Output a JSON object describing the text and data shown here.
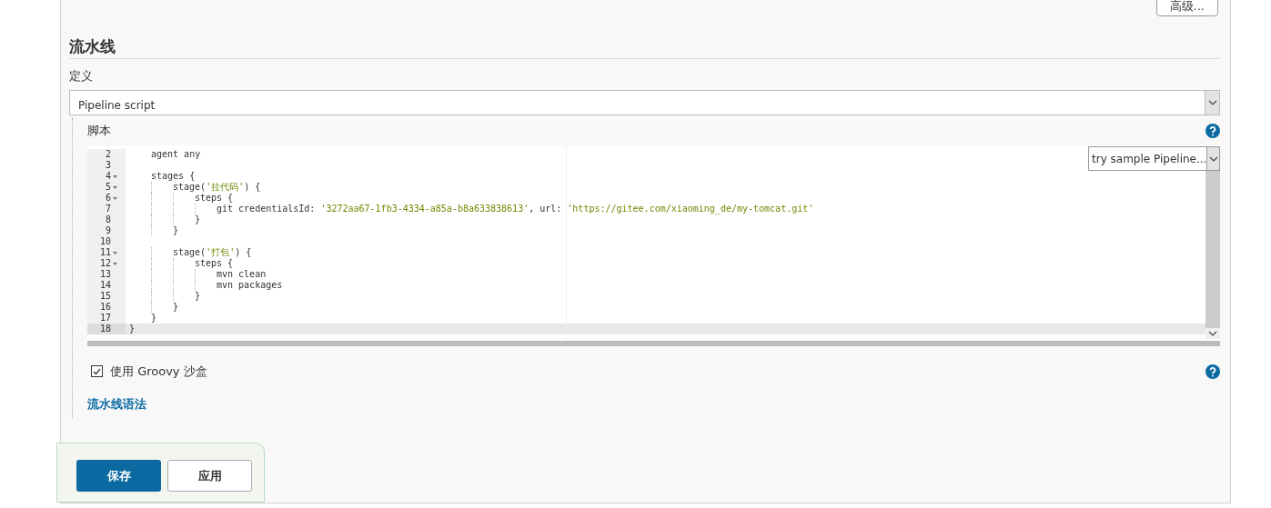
{
  "advanced_button": "高级...",
  "section_title": "流水线",
  "definition": {
    "label": "定义",
    "value": "Pipeline script"
  },
  "script": {
    "label": "脚本",
    "sample_select": "try sample Pipeline...",
    "lines": [
      {
        "number": "2",
        "foldable": false,
        "active": false,
        "segments": [
          {
            "kind": "plain",
            "text": "    agent any"
          }
        ]
      },
      {
        "number": "3",
        "foldable": false,
        "active": false
      },
      {
        "number": "4",
        "foldable": true,
        "active": false,
        "segments": [
          {
            "kind": "plain",
            "text": "    stages {"
          }
        ]
      },
      {
        "number": "5",
        "foldable": true,
        "active": false,
        "segments": [
          {
            "kind": "plain",
            "text": "        stage("
          },
          {
            "kind": "string",
            "text": "'拉代码'"
          },
          {
            "kind": "plain",
            "text": ") {"
          }
        ]
      },
      {
        "number": "6",
        "foldable": true,
        "active": false,
        "segments": [
          {
            "kind": "plain",
            "text": "            steps {"
          }
        ]
      },
      {
        "number": "7",
        "foldable": false,
        "active": false,
        "segments": [
          {
            "kind": "plain",
            "text": "                git credentialsId: "
          },
          {
            "kind": "string",
            "text": "'3272aa67-1fb3-4334-a85a-b8a633838613'"
          },
          {
            "kind": "plain",
            "text": ", url: "
          },
          {
            "kind": "string",
            "text": "'https://gitee.com/xiaoming_de/my-tomcat.git'"
          }
        ]
      },
      {
        "number": "8",
        "foldable": false,
        "active": false,
        "segments": [
          {
            "kind": "plain",
            "text": "            }"
          }
        ]
      },
      {
        "number": "9",
        "foldable": false,
        "active": false,
        "segments": [
          {
            "kind": "plain",
            "text": "        }"
          }
        ]
      },
      {
        "number": "10",
        "foldable": false,
        "active": false
      },
      {
        "number": "11",
        "foldable": true,
        "active": false,
        "segments": [
          {
            "kind": "plain",
            "text": "        stage("
          },
          {
            "kind": "string",
            "text": "'打包'"
          },
          {
            "kind": "plain",
            "text": ") {"
          }
        ]
      },
      {
        "number": "12",
        "foldable": true,
        "active": false,
        "segments": [
          {
            "kind": "plain",
            "text": "            steps {"
          }
        ]
      },
      {
        "number": "13",
        "foldable": false,
        "active": false,
        "segments": [
          {
            "kind": "plain",
            "text": "                mvn clean"
          }
        ]
      },
      {
        "number": "14",
        "foldable": false,
        "active": false,
        "segments": [
          {
            "kind": "plain",
            "text": "                mvn packages"
          }
        ]
      },
      {
        "number": "15",
        "foldable": false,
        "active": false,
        "segments": [
          {
            "kind": "plain",
            "text": "            }"
          }
        ]
      },
      {
        "number": "16",
        "foldable": false,
        "active": false,
        "segments": [
          {
            "kind": "plain",
            "text": "        }"
          }
        ]
      },
      {
        "number": "17",
        "foldable": false,
        "active": false,
        "segments": [
          {
            "kind": "plain",
            "text": "    }"
          }
        ]
      },
      {
        "number": "18",
        "foldable": false,
        "active": true,
        "segments": [
          {
            "kind": "plain",
            "text": "}"
          }
        ]
      }
    ]
  },
  "sandbox": {
    "label": "使用 Groovy 沙盒",
    "checked": true
  },
  "syntax_link": "流水线语法",
  "buttons": [
    {
      "label": "保存",
      "kind": "primary"
    },
    {
      "label": "应用",
      "kind": "secondary"
    }
  ]
}
